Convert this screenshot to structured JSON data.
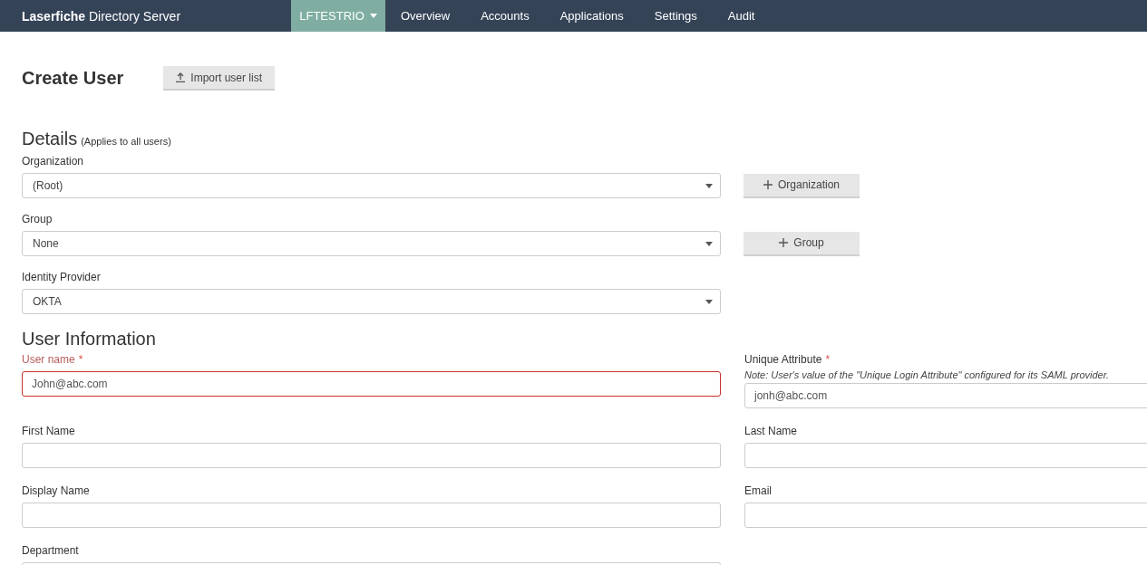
{
  "nav": {
    "brand": {
      "bold": "Laserfiche",
      "rest": "Directory Server"
    },
    "items": [
      {
        "label": "LFTESTRIO",
        "selected": true,
        "kind": "dropdown"
      },
      {
        "label": "Overview",
        "selected": false,
        "kind": "link"
      },
      {
        "label": "Accounts",
        "selected": false,
        "kind": "link"
      },
      {
        "label": "Applications",
        "selected": false,
        "kind": "link"
      },
      {
        "label": "Settings",
        "selected": false,
        "kind": "link"
      },
      {
        "label": "Audit",
        "selected": false,
        "kind": "link"
      }
    ]
  },
  "page": {
    "title": "Create User",
    "import_button": "Import user list"
  },
  "details": {
    "heading": "Details",
    "note": "(Applies to all users)",
    "fields": [
      {
        "label": "Organization",
        "value": "(Root)",
        "button": "Organization"
      },
      {
        "label": "Group",
        "value": "None",
        "button": "Group"
      },
      {
        "label": "Identity Provider",
        "value": "OKTA"
      }
    ]
  },
  "user_info": {
    "heading": "User Information",
    "rows": [
      [
        {
          "label": "User name",
          "marker": "*",
          "invalid": true,
          "value": "John@abc.com"
        },
        {
          "label": "Unique Attribute",
          "marker": "*",
          "invalid": false,
          "note": "Note: User's value of the \"Unique Login Attribute\" configured for its SAML provider.",
          "value": "jonh@abc.com"
        }
      ],
      [
        {
          "label": "First Name",
          "invalid": false
        },
        {
          "label": "Last Name",
          "invalid": false
        }
      ],
      [
        {
          "label": "Display Name",
          "invalid": false
        },
        {
          "label": "Email",
          "invalid": false
        }
      ],
      [
        {
          "label": "Department",
          "invalid": false
        }
      ]
    ]
  }
}
